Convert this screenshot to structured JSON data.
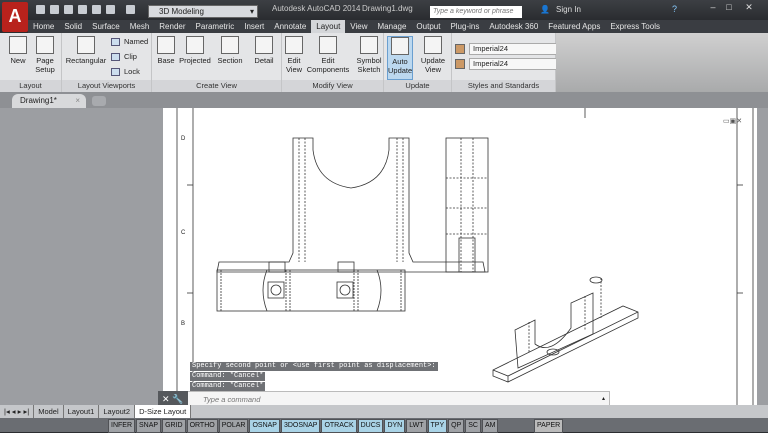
{
  "app": {
    "menu_icon": "autocad-logo",
    "workspace": "3D Modeling",
    "title": "Autodesk AutoCAD 2014",
    "document": "Drawing1.dwg",
    "search_placeholder": "Type a keyword or phrase",
    "sign_in": "Sign In"
  },
  "tabs": [
    "Home",
    "Solid",
    "Surface",
    "Mesh",
    "Render",
    "Parametric",
    "Insert",
    "Annotate",
    "Layout",
    "View",
    "Manage",
    "Output",
    "Plug-ins",
    "Autodesk 360",
    "Featured Apps",
    "Express Tools"
  ],
  "active_tab": "Layout",
  "ribbon": {
    "layout": {
      "label": "Layout",
      "new": "New",
      "page_setup": "Page Setup"
    },
    "viewports": {
      "label": "Layout Viewports",
      "rectangular": "Rectangular",
      "named": "Named",
      "clip": "Clip",
      "lock": "Lock"
    },
    "create_view": {
      "label": "Create View",
      "base": "Base",
      "projected": "Projected",
      "section": "Section",
      "detail": "Detail"
    },
    "modify_view": {
      "label": "Modify View",
      "edit_view": "Edit View",
      "edit_components": "Edit Components",
      "symbol_sketch": "Symbol Sketch"
    },
    "update": {
      "label": "Update",
      "auto_update": "Auto Update",
      "update_view": "Update View"
    },
    "styles": {
      "label": "Styles and Standards",
      "style1": "Imperial24",
      "style2": "Imperial24"
    }
  },
  "doc_tab": "Drawing1*",
  "border_labels": [
    "D",
    "C",
    "B"
  ],
  "command": {
    "history": [
      "Specify second point or <use first point as displacement>:",
      "Command: *Cancel*",
      "Command: *Cancel*"
    ],
    "placeholder": "Type a command"
  },
  "layout_tabs": [
    "Model",
    "Layout1",
    "Layout2",
    "D-Size Layout"
  ],
  "active_layout": "D-Size Layout",
  "status": {
    "toggles": [
      {
        "label": "INFER",
        "on": false
      },
      {
        "label": "SNAP",
        "on": false
      },
      {
        "label": "GRID",
        "on": false
      },
      {
        "label": "ORTHO",
        "on": false
      },
      {
        "label": "POLAR",
        "on": false
      },
      {
        "label": "OSNAP",
        "on": true
      },
      {
        "label": "3DOSNAP",
        "on": true
      },
      {
        "label": "OTRACK",
        "on": true
      },
      {
        "label": "DUCS",
        "on": true
      },
      {
        "label": "DYN",
        "on": true
      },
      {
        "label": "LWT",
        "on": false
      },
      {
        "label": "TPY",
        "on": true
      },
      {
        "label": "QP",
        "on": false
      },
      {
        "label": "SC",
        "on": false
      },
      {
        "label": "AM",
        "on": false
      }
    ],
    "space": "PAPER"
  }
}
